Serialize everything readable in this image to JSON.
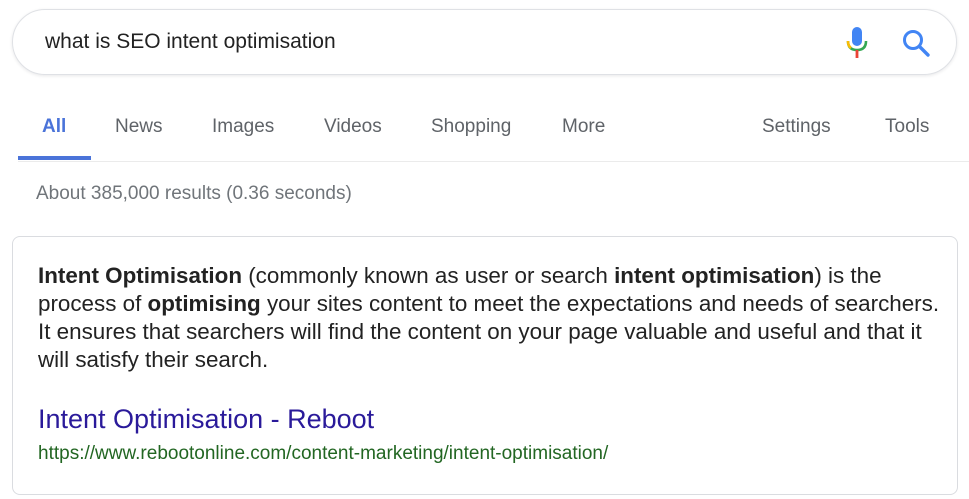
{
  "search": {
    "query": "what is SEO intent optimisation",
    "mic_icon": "microphone-icon",
    "search_icon": "magnifier-icon"
  },
  "tabs": {
    "items": [
      {
        "label": "All",
        "active": true
      },
      {
        "label": "News",
        "active": false
      },
      {
        "label": "Images",
        "active": false
      },
      {
        "label": "Videos",
        "active": false
      },
      {
        "label": "Shopping",
        "active": false
      },
      {
        "label": "More",
        "active": false
      }
    ],
    "settings_label": "Settings",
    "tools_label": "Tools"
  },
  "results": {
    "stats": "About 385,000 results (0.36 seconds)"
  },
  "snippet": {
    "parts": {
      "p1": "Intent Optimisation",
      "p2": " (commonly known as user or search ",
      "p3": "intent optimisation",
      "p4": ") is the process of ",
      "p5": "optimising",
      "p6": " your sites content to meet the expectations and needs of searchers. It ensures that searchers will find the content on your page valuable and useful and that it will satisfy their search."
    },
    "title": "Intent Optimisation - Reboot",
    "url": "https://www.rebootonline.com/content-marketing/intent-optimisation/"
  },
  "colors": {
    "accent_tab": "#4a73d9",
    "link": "#2a1a9a",
    "url_green": "#226622",
    "muted_text": "#70757a"
  }
}
